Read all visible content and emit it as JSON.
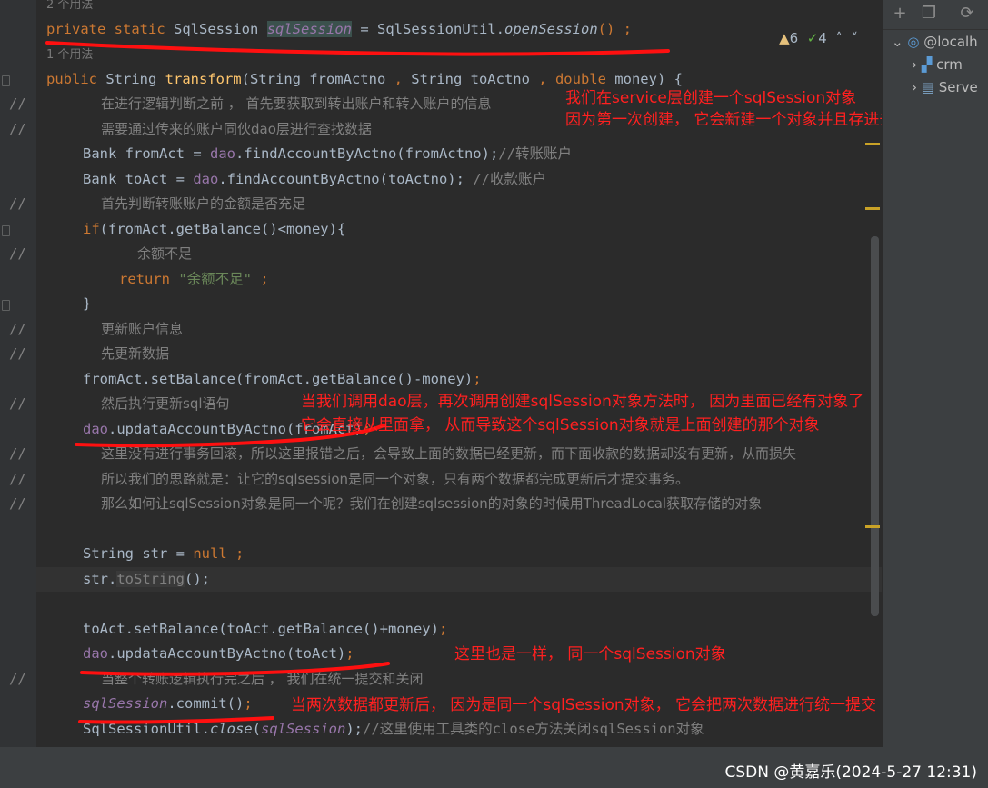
{
  "usages": {
    "top": "2 个用法",
    "method": "1 个用法"
  },
  "status": {
    "warnings": "6",
    "checks": "4"
  },
  "code": {
    "field_decl": {
      "mod1": "private",
      "mod2": "static",
      "type": "SqlSession",
      "name": "sqlSession",
      "eq": " = SqlSessionUtil.",
      "call": "openSession",
      "tail": "() ;"
    },
    "method_sig": {
      "kw1": "public",
      "type": " String ",
      "name": "transform",
      "p1": "(String fromActno",
      "sep": " , ",
      "p2": "String toActno",
      "sep2": " , ",
      "kw2": "double",
      "p3": " money) {"
    },
    "c1": "在进行逻辑判断之前 ， 首先要获取到转出账户和转入账户的信息",
    "c2": "需要通过传来的账户同伙dao层进行查找数据",
    "l_from": {
      "a": "Bank fromAct = ",
      "dao": "dao",
      "b": ".findAccountByActno(fromActno);",
      "c": "//转账账户"
    },
    "l_to": {
      "a": "Bank toAct = ",
      "dao": "dao",
      "b": ".findAccountByActno(toActno);",
      "c": " //收款账户"
    },
    "c3": "首先判断转账账户的金额是否充足",
    "l_if": {
      "kw": "if",
      "b": "(fromAct.getBalance()<money){"
    },
    "c4": "余额不足",
    "l_ret": {
      "kw": "return ",
      "s": "\"余额不足\"",
      "end": " ;"
    },
    "l_close": "}",
    "c5": "更新账户信息",
    "c6": "先更新数据",
    "l_set1": {
      "a": "fromAct.setBalance(fromAct.getBalance()-money)",
      "end": ";"
    },
    "c7": "然后执行更新sql语句",
    "l_upd1": {
      "dao": "dao",
      "a": ".updataAccountByActno(fromAct)",
      "end": ";"
    },
    "c8": "这里没有进行事务回滚，所以这里报错之后，会导致上面的数据已经更新，而下面收款的数据却没有更新，从而损失",
    "c9": "所以我们的思路就是：让它的sqlsession是同一个对象，只有两个数据都完成更新后才提交事务。",
    "c10": "那么如何让sqlSession对象是同一个呢？我们在创建sqlsession的对象的时候用ThreadLocal获取存储的对象",
    "l_str": {
      "a": "String str = ",
      "kw": "null",
      "end": " ;"
    },
    "l_tostr": {
      "a": "str.",
      "g": "toString",
      "b": "();"
    },
    "l_set2": {
      "a": "toAct.setBalance(toAct.getBalance()+money)",
      "end": ";"
    },
    "l_upd2": {
      "dao": "dao",
      "a": ".updataAccountByActno(toAct)",
      "end": ";"
    },
    "c11": "当整个转账逻辑执行完之后 ， 我们在统一提交和关闭",
    "l_commit": {
      "f": "sqlSession",
      "a": ".commit()",
      "end": ";"
    },
    "l_close2": {
      "a": "SqlSessionUtil.",
      "m": "close",
      "b": "(",
      "f": "sqlSession",
      "c": ");",
      "cm": "//这里使用工具类的close方法关闭sqlSession对象"
    }
  },
  "notes": {
    "n1a": "我们在service层创建一个sqlSession对象",
    "n1b": "因为第一次创建， 它会新建一个对象并且存进去",
    "n2a": "当我们调用dao层，再次调用创建sqlSession对象方法时， 因为里面已经有对象了",
    "n2b": "它会直接从里面拿， 从而导致这个sqlSession对象就是上面创建的那个对象",
    "n3": "这里也是一样， 同一个sqlSession对象",
    "n4": "当两次数据都更新后， 因为是同一个sqlSession对象， 它会把两次数据进行统一提交"
  },
  "sidebar": {
    "db": "@localh",
    "crm": "crm",
    "server": "Serve"
  },
  "watermark": "CSDN @黄嘉乐(2024-5-27 12:31)",
  "colors": {
    "annotation": "#ff2020",
    "keyword": "#cc7832",
    "field": "#9876aa",
    "string": "#6a8759"
  }
}
